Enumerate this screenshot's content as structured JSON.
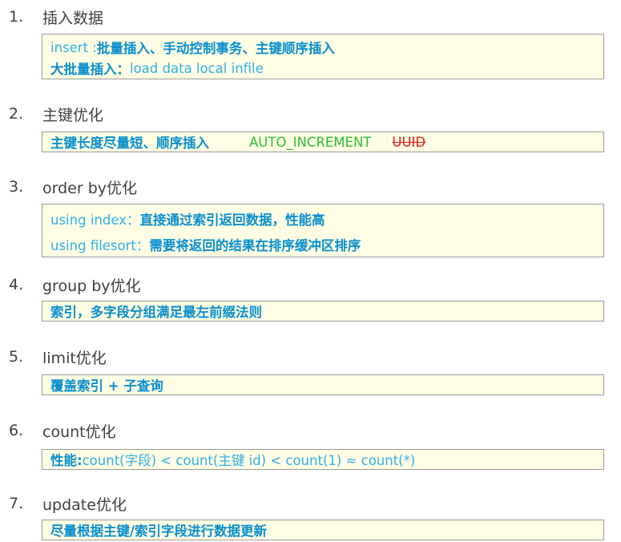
{
  "sections": [
    {
      "num": "1.",
      "title": "插入数据",
      "lines": [
        {
          "a": "insert : ",
          "b": "批量插入、手动控制事务、主键顺序插入"
        },
        {
          "a": "大批量插入：",
          "b": "load  data  local  infile"
        }
      ]
    },
    {
      "num": "2.",
      "title": "主键优化",
      "lines": [
        {
          "a": "主键长度尽量短、顺序插入",
          "b": "AUTO_INCREMENT",
          "c": "UUID"
        }
      ]
    },
    {
      "num": "3.",
      "title": "order by优化",
      "lines": [
        {
          "a": "using index：",
          "b": "直接通过索引返回数据，性能高"
        },
        {
          "a": "using filesort：",
          "b": "需要将返回的结果在排序缓冲区排序"
        }
      ]
    },
    {
      "num": "4.",
      "title": "group by优化",
      "lines": [
        {
          "a": "索引，多字段分组满足最左前缀法则"
        }
      ]
    },
    {
      "num": "5.",
      "title": "limit优化",
      "lines": [
        {
          "a": "覆盖索引 + 子查询"
        }
      ]
    },
    {
      "num": "6.",
      "title": "count优化",
      "lines": [
        {
          "a": "性能: ",
          "b": "count(字段) < count(主键 id) < count(1) ≈ count(*)"
        }
      ]
    },
    {
      "num": "7.",
      "title": "update优化",
      "lines": [
        {
          "a": "尽量根据主键/索引字段进行数据更新"
        }
      ]
    }
  ]
}
